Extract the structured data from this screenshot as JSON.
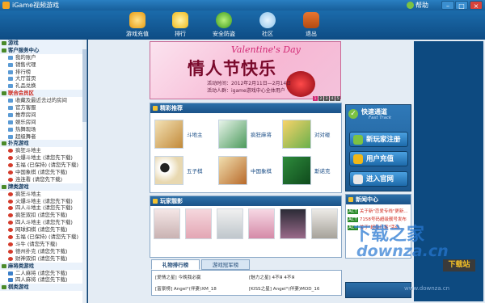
{
  "window": {
    "title": "iGame视频游戏",
    "help": "帮助",
    "min": "–",
    "max": "□",
    "close": "×"
  },
  "toolbar": [
    {
      "label": "游戏充值",
      "icon": "coin-icon"
    },
    {
      "label": "排行",
      "icon": "trophy-icon"
    },
    {
      "label": "安全防盗",
      "icon": "lock-icon"
    },
    {
      "label": "社区",
      "icon": "chat-icon"
    },
    {
      "label": "退出",
      "icon": "exit-icon"
    }
  ],
  "sidebar": [
    {
      "type": "cat",
      "label": "游戏"
    },
    {
      "type": "cat",
      "label": "客户服务中心"
    },
    {
      "type": "sub",
      "label": "我的账户"
    },
    {
      "type": "sub",
      "label": "销售代理"
    },
    {
      "type": "sub",
      "label": "排行榜"
    },
    {
      "type": "sub",
      "label": "大厅首页"
    },
    {
      "type": "sub",
      "label": "礼品兑换"
    },
    {
      "type": "cat",
      "label": "联合会员区",
      "red": true
    },
    {
      "type": "sub",
      "label": "收藏及最近去过的房间"
    },
    {
      "type": "sub",
      "label": "官方客服"
    },
    {
      "type": "sub",
      "label": "推荐房间"
    },
    {
      "type": "sub",
      "label": "娱乐房间"
    },
    {
      "type": "sub",
      "label": "热舞现场"
    },
    {
      "type": "sub",
      "label": "超级舞者"
    },
    {
      "type": "cat",
      "label": "扑克游戏"
    },
    {
      "type": "sub",
      "label": "疯狂斗地主",
      "dot": "red"
    },
    {
      "type": "sub",
      "label": "火爆斗地主 (请您先下载)",
      "dot": "red"
    },
    {
      "type": "sub",
      "label": "五福 (已保持) (请您先下载)",
      "dot": "red"
    },
    {
      "type": "sub",
      "label": "中国象棋 (请您先下载)",
      "dot": "red"
    },
    {
      "type": "sub",
      "label": "连连看 (请您先下载)",
      "dot": "red"
    },
    {
      "type": "cat",
      "label": "牌类游戏"
    },
    {
      "type": "sub",
      "label": "疯狂斗地主",
      "dot": "red"
    },
    {
      "type": "sub",
      "label": "火爆斗地主 (请您先下载)",
      "dot": "red"
    },
    {
      "type": "sub",
      "label": "四人斗地主 (请您先下载)",
      "dot": "red"
    },
    {
      "type": "sub",
      "label": "疯狂双扣 (请您先下载)",
      "dot": "red"
    },
    {
      "type": "sub",
      "label": "四人斗地主 (请您先下载)",
      "dot": "red"
    },
    {
      "type": "sub",
      "label": "网球扣棋 (请您先下载)",
      "dot": "red"
    },
    {
      "type": "sub",
      "label": "五福 (已保持) (请您先下载)",
      "dot": "red"
    },
    {
      "type": "sub",
      "label": "斗牛 (请您先下载)",
      "dot": "red"
    },
    {
      "type": "sub",
      "label": "德州扑克 (请您先下载)",
      "dot": "red"
    },
    {
      "type": "sub",
      "label": "财神双扣 (请您先下载)",
      "dot": "red"
    },
    {
      "type": "cat",
      "label": "麻将类游戏"
    },
    {
      "type": "sub",
      "label": "二人麻将 (请您先下载)",
      "dot": "blue"
    },
    {
      "type": "sub",
      "label": "四人麻将 (请您先下载)",
      "dot": "blue"
    },
    {
      "type": "cat",
      "label": "棋类游戏"
    }
  ],
  "banner": {
    "en": "Valentine's Day",
    "cn": "情人节快乐",
    "time": "活动时间：2012年2月11日—2月14日",
    "who": "活动人群：igame游戏中心全体用户",
    "dots": [
      "1",
      "2",
      "3",
      "4",
      "5"
    ]
  },
  "featured": {
    "title": "精彩推荐",
    "games": [
      {
        "name": "斗地主"
      },
      {
        "name": "疯狂麻将"
      },
      {
        "name": "对对碰"
      },
      {
        "name": "五子棋"
      },
      {
        "name": "中国象棋"
      },
      {
        "name": "斯诺克"
      }
    ]
  },
  "players": {
    "title": "玩家靓影"
  },
  "tabs": [
    "礼物排行榜",
    "游戏冠军榜"
  ],
  "ranks": [
    "[爱情之星] 今晚我必赢",
    "[魅力之星] 4不Я 4不Я",
    "[富豪榜] Angel°(伴妻)XM_18",
    "[KISS之星] Angel°(伴妻)MOD_16"
  ],
  "fasttrack": {
    "title": "快速通道",
    "sub": "Fast Track",
    "buttons": [
      "新玩家注册",
      "用户充值",
      "进入官网"
    ]
  },
  "news": {
    "title": "新闻中心",
    "items": [
      {
        "tag": "ACT",
        "text": "关于新\"恋爱专线\"更新..."
      },
      {
        "tag": "ACT",
        "text": "7158号码超级靓号发布"
      },
      {
        "tag": "ACT",
        "text": "关于\"超级乐事\"活动..."
      }
    ]
  },
  "watermark": {
    "cn": "下载之家",
    "en": "downza.cn",
    "site": "下载站",
    "url": "www.downza.cn"
  },
  "colors": {
    "accent": "#1b5288",
    "brand_pink": "#d02a74",
    "link_red": "#d0281c"
  }
}
